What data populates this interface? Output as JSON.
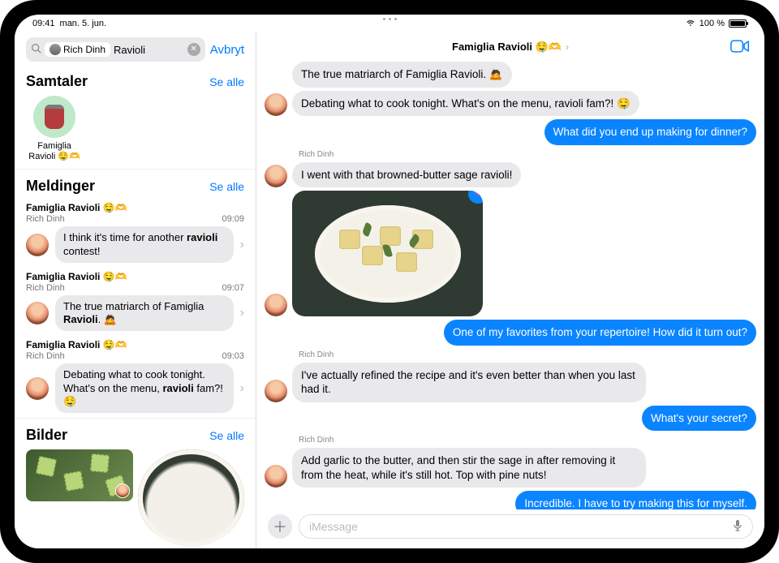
{
  "status": {
    "time": "09:41",
    "date": "man. 5. jun.",
    "battery_pct": "100 %"
  },
  "sidebar": {
    "search": {
      "pill_name": "Rich Dinh",
      "query": "Ravioli",
      "cancel": "Avbryt"
    },
    "sections": {
      "conversations": {
        "title": "Samtaler",
        "see_all": "Se alle"
      },
      "messages": {
        "title": "Meldinger",
        "see_all": "Se alle"
      },
      "images": {
        "title": "Bilder",
        "see_all": "Se alle"
      }
    },
    "conversation_results": [
      {
        "name_line1": "Famiglia",
        "name_line2": "Ravioli 🤤🫶"
      }
    ],
    "message_results": [
      {
        "group": "Famiglia Ravioli 🤤🫶",
        "sender": "Rich Dinh",
        "time": "09:09",
        "text_pre": "I think it's time for another ",
        "text_bold": "ravioli",
        "text_post": " contest!"
      },
      {
        "group": "Famiglia Ravioli 🤤🫶",
        "sender": "Rich Dinh",
        "time": "09:07",
        "text_pre": "The true matriarch of Famiglia ",
        "text_bold": "Ravioli",
        "text_post": ". 🙇"
      },
      {
        "group": "Famiglia Ravioli 🤤🫶",
        "sender": "Rich Dinh",
        "time": "09:03",
        "text_pre": "Debating what to cook tonight. What's on the menu, ",
        "text_bold": "ravioli",
        "text_post": " fam?! 🤤"
      }
    ]
  },
  "chat": {
    "title": "Famiglia Ravioli 🤤🫶",
    "messages": [
      {
        "dir": "received",
        "sender": "",
        "avatar": false,
        "text": "The true matriarch of Famiglia Ravioli. 🙇"
      },
      {
        "dir": "received",
        "sender": "",
        "avatar": true,
        "text": "Debating what to cook tonight. What's on the menu, ravioli fam?! 🤤"
      },
      {
        "dir": "sent",
        "text": "What did you end up making for dinner?"
      },
      {
        "dir": "received_name",
        "name": "Rich Dinh"
      },
      {
        "dir": "received",
        "sender": "Rich Dinh",
        "avatar": true,
        "text": "I went with that browned-butter sage ravioli!"
      },
      {
        "dir": "received_image",
        "avatar": true,
        "tapback": "heart"
      },
      {
        "dir": "sent",
        "text": "One of my favorites from your repertoire! How did it turn out?"
      },
      {
        "dir": "received_name",
        "name": "Rich Dinh"
      },
      {
        "dir": "received",
        "sender": "Rich Dinh",
        "avatar": true,
        "text": "I've actually refined the recipe and it's even better than when you last had it."
      },
      {
        "dir": "sent",
        "text": "What's your secret?"
      },
      {
        "dir": "received_name",
        "name": "Rich Dinh"
      },
      {
        "dir": "received",
        "sender": "Rich Dinh",
        "avatar": true,
        "text": "Add garlic to the butter, and then stir the sage in after removing it from the heat, while it's still hot. Top with pine nuts!"
      },
      {
        "dir": "sent",
        "text": "Incredible. I have to try making this for myself."
      }
    ],
    "composer_placeholder": "iMessage"
  }
}
